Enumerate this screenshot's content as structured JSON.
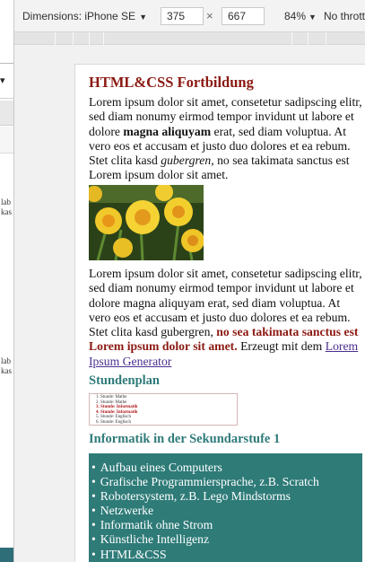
{
  "toolbar": {
    "device_label": "Dimensions: iPhone SE",
    "width_value": "375",
    "height_value": "667",
    "times_sign": "×",
    "zoom_label": "84%",
    "throttle_label": "No throttling"
  },
  "background_window": {
    "text_lines_top": [
      "lab",
      "kas"
    ],
    "text_lines_bottom": [
      "lab",
      "kas"
    ]
  },
  "page": {
    "title": "HTML&CSS Fortbildung",
    "p1": {
      "text_before_bold": "Lorem ipsum dolor sit amet, consetetur sadipscing elitr, sed diam nonumy eirmod tempor invidunt ut labore et dolore ",
      "bold": "magna aliquyam",
      "text_before_italic": " erat, sed diam voluptua. At vero eos et accusam et justo duo dolores et ea rebum. Stet clita kasd ",
      "italic": "gubergren",
      "text_after": ", no sea takimata sanctus est Lorem ipsum dolor sit amet."
    },
    "image_alt": "Narzissen",
    "p2": {
      "text": "Lorem ipsum dolor sit amet, consetetur sadipscing elitr, sed diam nonumy eirmod tempor invidunt ut labore et dolore magna aliquyam erat, sed diam voluptua. At vero eos et accusam et justo duo dolores et ea rebum. Stet clita kasd gubergren, ",
      "highlight": "no sea takimata sanctus est Lorem ipsum dolor sit amet.",
      "text_before_link": " Erzeugt mit dem ",
      "link": "Lorem Ipsum Generator"
    },
    "schedule_heading": "Stundenplan",
    "schedule_items": [
      {
        "text": "1. Stunde: Mathe",
        "highlight": false
      },
      {
        "text": "2. Stunde: Mathe",
        "highlight": false
      },
      {
        "text": "3. Stunde: Informatik",
        "highlight": true
      },
      {
        "text": "4. Stunde: Informatik",
        "highlight": true
      },
      {
        "text": "5. Stunde: Englisch",
        "highlight": false
      },
      {
        "text": "6. Stunde: Englisch",
        "highlight": false
      }
    ],
    "section_heading": "Informatik in der Sekundarstufe 1",
    "topics": [
      "Aufbau eines Computers",
      "Grafische Programmiersprache, z.B. Scratch",
      "Robotersystem, z.B. Lego Mindstorms",
      "Netzwerke",
      "Informatik ohne Strom",
      "Künstliche Intelligenz",
      "HTML&CSS"
    ]
  },
  "colors": {
    "heading_red": "#8b1a12",
    "heading_teal": "#2f7a7a",
    "list_box_bg": "#2e7b78",
    "link": "#4a2f8f"
  }
}
